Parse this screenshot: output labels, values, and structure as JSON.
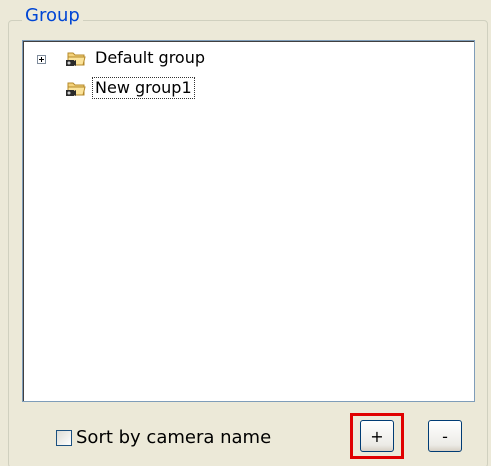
{
  "group": {
    "legend": "Group",
    "tree": [
      {
        "label": "Default group",
        "expandable": true,
        "selected": false
      },
      {
        "label": "New group1",
        "expandable": false,
        "selected": true
      }
    ]
  },
  "sort_checkbox": {
    "label": "Sort by camera name",
    "checked": false
  },
  "buttons": {
    "add_label": "+",
    "remove_label": "-"
  },
  "icons": {
    "expand": "plus-expander-icon",
    "folder": "camera-folder-icon"
  },
  "colors": {
    "legend_text": "#0046d5",
    "highlight": "#e00000"
  }
}
